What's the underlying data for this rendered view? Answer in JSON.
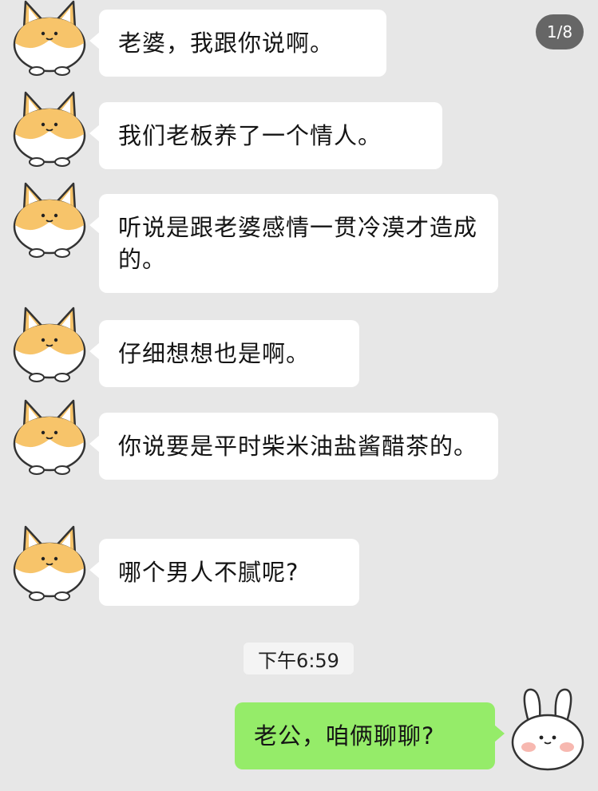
{
  "page_indicator": "1/8",
  "timestamp": "下午6:59",
  "messages": [
    {
      "sender": "other",
      "text": "老婆，我跟你说啊。",
      "avatar_icon": "corgi-icon"
    },
    {
      "sender": "other",
      "text": "我们老板养了一个情人。",
      "avatar_icon": "corgi-icon"
    },
    {
      "sender": "other",
      "text": "听说是跟老婆感情一贯冷漠才造成的。",
      "avatar_icon": "corgi-icon"
    },
    {
      "sender": "other",
      "text": "仔细想想也是啊。",
      "avatar_icon": "corgi-icon"
    },
    {
      "sender": "other",
      "text": "你说要是平时柴米油盐酱醋茶的。",
      "avatar_icon": "corgi-icon"
    },
    {
      "sender": "other",
      "text": "哪个男人不腻呢?",
      "avatar_icon": "corgi-icon"
    },
    {
      "sender": "me",
      "text": "老公，咱俩聊聊?",
      "avatar_icon": "bunny-icon"
    }
  ],
  "colors": {
    "background": "#e7e7e7",
    "incoming_bubble": "#ffffff",
    "outgoing_bubble": "#95ec69",
    "corgi_orange": "#f7c46a"
  }
}
